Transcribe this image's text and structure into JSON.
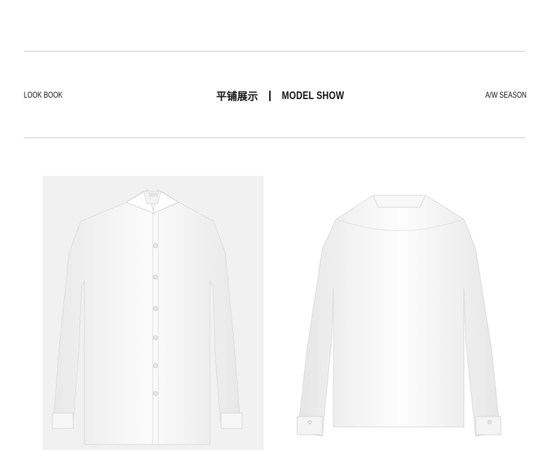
{
  "header": {
    "left_label": "LOOK BOOK",
    "title_cn": "平铺展示",
    "title_en": "MODEL SHOW",
    "right_label": "A/W SEASON"
  },
  "gallery": {
    "items": [
      {
        "view": "front",
        "icon": "shirt-front-image"
      },
      {
        "view": "back",
        "icon": "shirt-back-image"
      }
    ]
  },
  "colors": {
    "rule": "#c9c9c9",
    "front_background": "#f1f1f1",
    "text": "#111111"
  }
}
